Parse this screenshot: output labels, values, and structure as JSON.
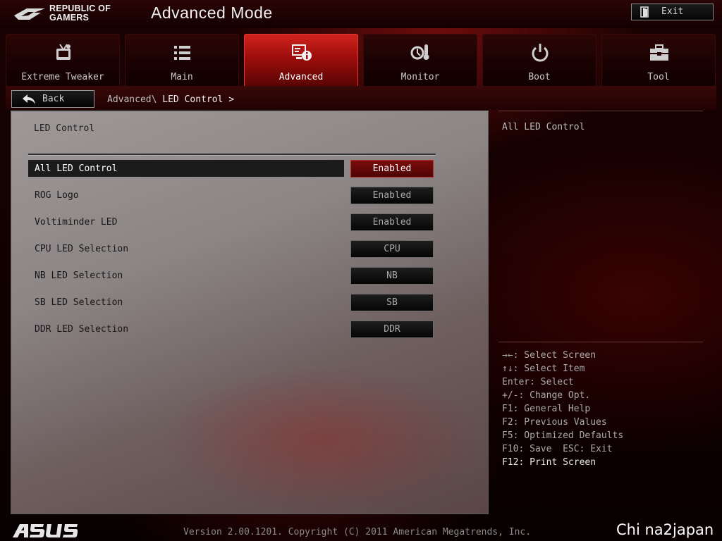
{
  "header": {
    "brand_line1": "REPUBLIC OF",
    "brand_line2": "GAMERS",
    "title": "Advanced Mode",
    "exit_label": "Exit"
  },
  "tabs": [
    {
      "label": "Extreme Tweaker",
      "icon": "tweaker-icon",
      "active": false
    },
    {
      "label": "Main",
      "icon": "list-icon",
      "active": false
    },
    {
      "label": "Advanced",
      "icon": "advanced-info-icon",
      "active": true
    },
    {
      "label": "Monitor",
      "icon": "thermometer-icon",
      "active": false
    },
    {
      "label": "Boot",
      "icon": "power-icon",
      "active": false
    },
    {
      "label": "Tool",
      "icon": "toolbox-icon",
      "active": false
    }
  ],
  "breadcrumb": {
    "back_label": "Back",
    "path": "Advanced\\",
    "current": "LED Control >"
  },
  "main": {
    "section_title": "LED Control",
    "items": [
      {
        "label": "All LED Control",
        "value": "Enabled",
        "selected": true
      },
      {
        "label": "ROG Logo",
        "value": "Enabled",
        "selected": false
      },
      {
        "label": "Voltiminder LED",
        "value": "Enabled",
        "selected": false
      },
      {
        "label": "CPU LED Selection",
        "value": "CPU",
        "selected": false
      },
      {
        "label": "NB LED Selection",
        "value": "NB",
        "selected": false
      },
      {
        "label": "SB LED Selection",
        "value": "SB",
        "selected": false
      },
      {
        "label": "DDR LED Selection",
        "value": "DDR",
        "selected": false
      }
    ]
  },
  "help": {
    "title": "All LED Control",
    "keys": [
      "→←: Select Screen",
      "↑↓: Select Item",
      "Enter: Select",
      "+/-: Change Opt.",
      "F1: General Help",
      "F2: Previous Values",
      "F5: Optimized Defaults",
      "F10: Save  ESC: Exit",
      "F12: Print Screen"
    ]
  },
  "footer": {
    "logo": "ASUS",
    "version": "Version 2.00.1201. Copyright (C) 2011 American Megatrends, Inc.",
    "watermark": "Chi na2japan"
  },
  "colors": {
    "accent_red": "#c8201a",
    "selected_value_bg": "#6a0808",
    "panel_gray": "#8c8585"
  }
}
